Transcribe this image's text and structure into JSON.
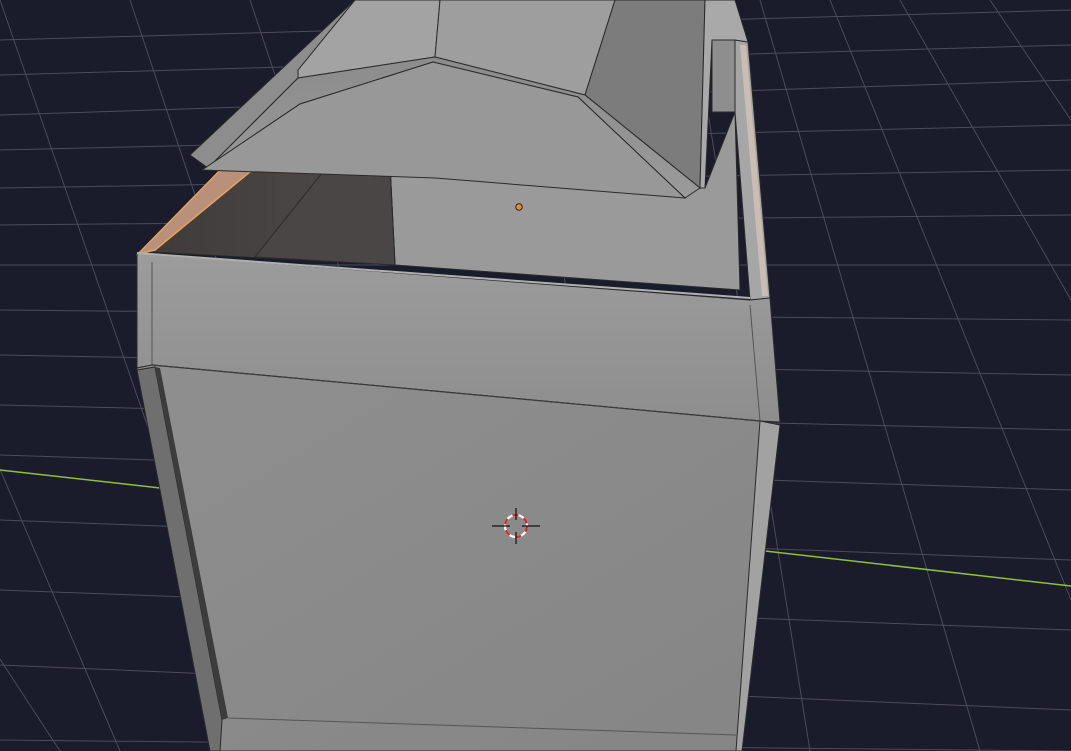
{
  "app": {
    "context": "3D viewport",
    "mode": "object"
  },
  "colors": {
    "background": "#1a1b2b",
    "grid_line": "#4a4b5c",
    "x_axis": "#8fbf3b",
    "mesh_light": "#9a9a9a",
    "mesh_mid": "#8a8a8a",
    "mesh_dark": "#505050",
    "mesh_edge": "#2a2a2a",
    "selection": "#e8a060",
    "origin_dot": "#ff8c1a",
    "cursor_red": "#d22a2a",
    "cursor_white": "#ffffff"
  },
  "icons": {
    "cursor": "3d-cursor-icon",
    "origin": "object-origin-icon"
  }
}
